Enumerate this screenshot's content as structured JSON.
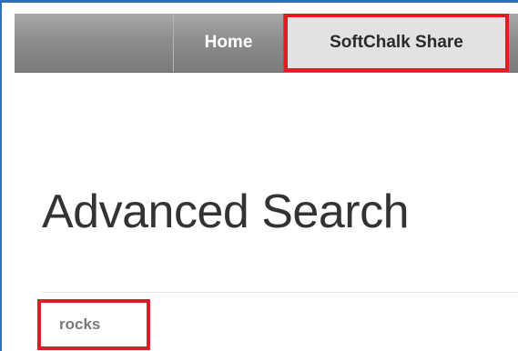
{
  "nav": {
    "items": [
      {
        "label": "Home"
      },
      {
        "label": "SoftChalk Share"
      }
    ]
  },
  "main": {
    "title": "Advanced Search",
    "keyword": "rocks"
  },
  "colors": {
    "highlight": "#e01c24",
    "window_border": "#2f6fb7",
    "nav_bg": "#8d8d8d",
    "active_tab_bg": "#e2e2e2"
  }
}
